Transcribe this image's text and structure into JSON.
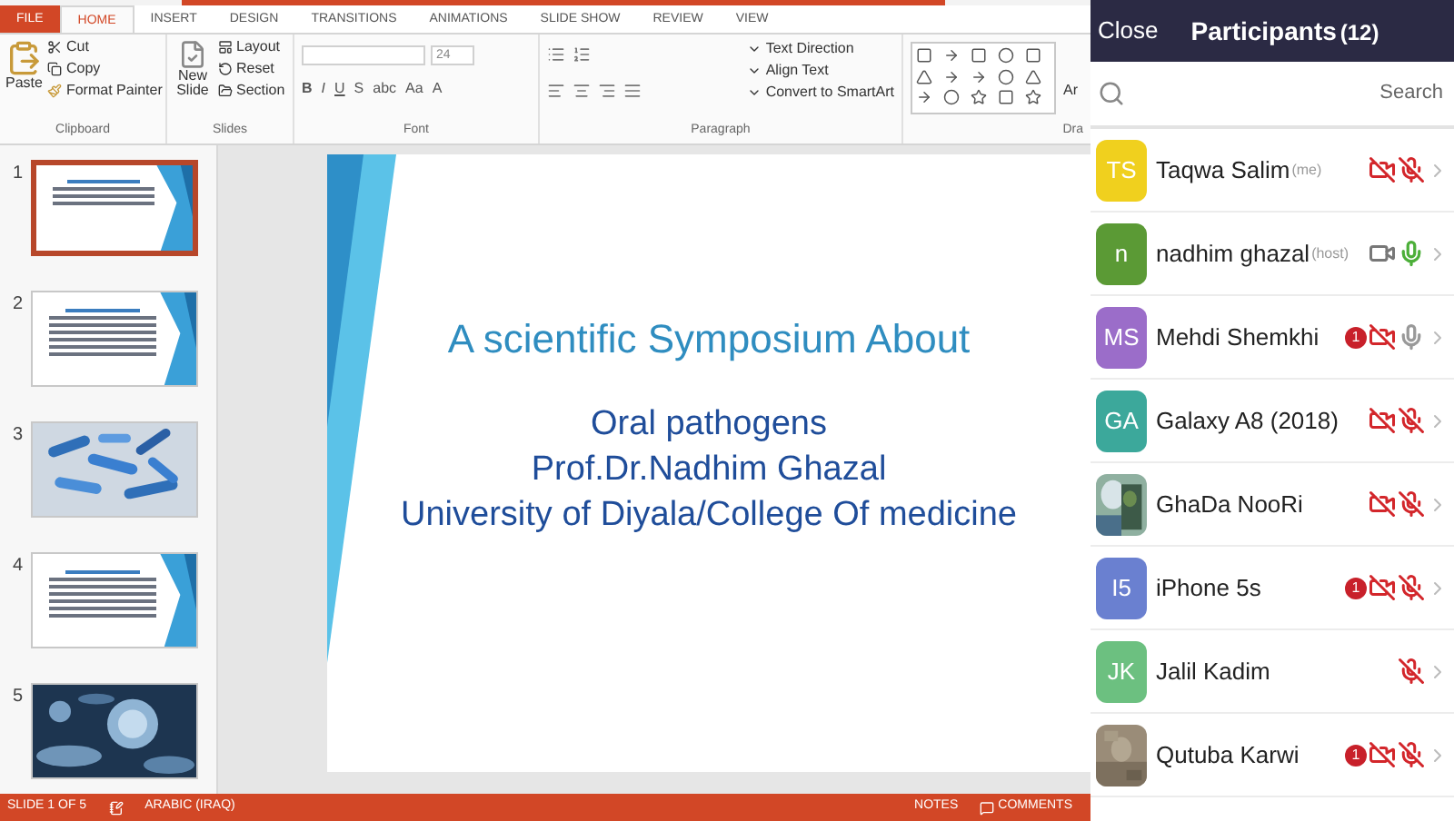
{
  "file_tab": "FILE",
  "tabs": [
    {
      "label": "HOME",
      "selected": true
    },
    {
      "label": "INSERT",
      "selected": false
    },
    {
      "label": "DESIGN",
      "selected": false
    },
    {
      "label": "TRANSITIONS",
      "selected": false
    },
    {
      "label": "ANIMATIONS",
      "selected": false
    },
    {
      "label": "SLIDE SHOW",
      "selected": false
    },
    {
      "label": "REVIEW",
      "selected": false
    },
    {
      "label": "VIEW",
      "selected": false
    }
  ],
  "ribbon": {
    "clipboard": {
      "paste": "Paste",
      "cut": "Cut",
      "copy": "Copy",
      "format_painter": "Format Painter",
      "label": "Clipboard"
    },
    "slides": {
      "new_slide": "New Slide",
      "layout": "Layout",
      "reset": "Reset",
      "section": "Section",
      "label": "Slides"
    },
    "font": {
      "size": "24",
      "buttons": [
        "B",
        "I",
        "U",
        "S",
        "abc",
        "Aa",
        "A"
      ],
      "label": "Font"
    },
    "paragraph": {
      "text_direction": "Text Direction",
      "align_text": "Align Text",
      "convert": "Convert to SmartArt",
      "label": "Paragraph"
    },
    "drawing": {
      "arrange": "Ar",
      "label": "Dra"
    }
  },
  "thumbnails": [
    {
      "number": "1",
      "kind": "title",
      "selected": true
    },
    {
      "number": "2",
      "kind": "text",
      "selected": false
    },
    {
      "number": "3",
      "kind": "picture",
      "selected": false
    },
    {
      "number": "4",
      "kind": "text",
      "selected": false
    },
    {
      "number": "5",
      "kind": "picture",
      "selected": false
    }
  ],
  "slide": {
    "title": "A scientific Symposium About",
    "lines": [
      "Oral pathogens",
      "Prof.Dr.Nadhim Ghazal",
      "University of Diyala/College Of medicine"
    ]
  },
  "status_bar": {
    "slide": "SLIDE 1 OF 5",
    "language": "ARABIC (IRAQ)",
    "notes": "NOTES",
    "comments": "COMMENTS"
  },
  "participants": {
    "close": "Close",
    "title": "Participants",
    "count": "(12)",
    "search": {
      "placeholder": "Search"
    },
    "items": [
      {
        "name": "Taqwa Salim",
        "tag": "(me)",
        "initials": "TS",
        "color": "#f0d01e",
        "camera_on": false,
        "mic_muted": true
      },
      {
        "name": "nadhim ghazal",
        "tag": "(host)",
        "initials": "n",
        "color": "#5b9a35",
        "camera_on": true,
        "mic_muted": false,
        "speaking": true
      },
      {
        "name": "Mehdi Shemkhi",
        "initials": "MS",
        "color": "#9b6dc9",
        "badge": "1",
        "camera_on": false,
        "mic_muted": false,
        "speaking": false
      },
      {
        "name": "Galaxy A8 (2018)",
        "initials": "GA",
        "color": "#3ca89b",
        "camera_on": false,
        "mic_muted": true
      },
      {
        "name": "GhaDa NooRi",
        "kind": "picture",
        "camera_on": false,
        "mic_muted": true
      },
      {
        "name": "iPhone 5s",
        "initials": "I5",
        "color": "#6a80d0",
        "badge": "1",
        "camera_on": false,
        "mic_muted": true
      },
      {
        "name": "Jalil Kadim",
        "initials": "JK",
        "color": "#6cc080",
        "mic_muted": true
      },
      {
        "name": "Qutuba Karwi",
        "kind": "picture",
        "badge": "1",
        "camera_on": false,
        "mic_muted": true
      }
    ]
  }
}
